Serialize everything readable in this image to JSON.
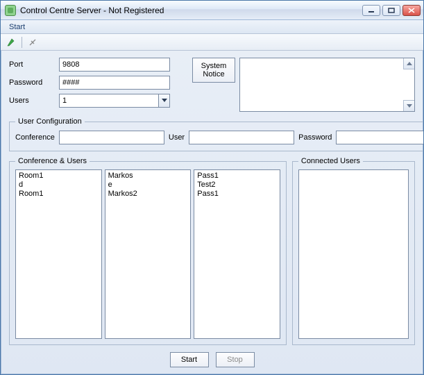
{
  "window": {
    "title": "Control Centre Server - Not Registered"
  },
  "menubar": {
    "start": "Start"
  },
  "form": {
    "port_label": "Port",
    "port_value": "9808",
    "password_label": "Password",
    "password_value": "####",
    "users_label": "Users",
    "users_value": "1"
  },
  "notice": {
    "system_notice_btn": "System\nNotice"
  },
  "user_config": {
    "legend": "User Configuration",
    "conference_label": "Conference",
    "conference_value": "",
    "user_label": "User",
    "user_value": "",
    "password_label": "Password",
    "password_value": "",
    "add_btn": "+"
  },
  "conf_users": {
    "legend": "Conference & Users",
    "col_conference": [
      "Room1",
      "d",
      "Room1"
    ],
    "col_user": [
      "Markos",
      "e",
      "Markos2"
    ],
    "col_password": [
      "Pass1",
      "Test2",
      "Pass1"
    ]
  },
  "connected_users": {
    "legend": "Connected Users",
    "items": []
  },
  "bottom": {
    "start": "Start",
    "stop": "Stop"
  }
}
